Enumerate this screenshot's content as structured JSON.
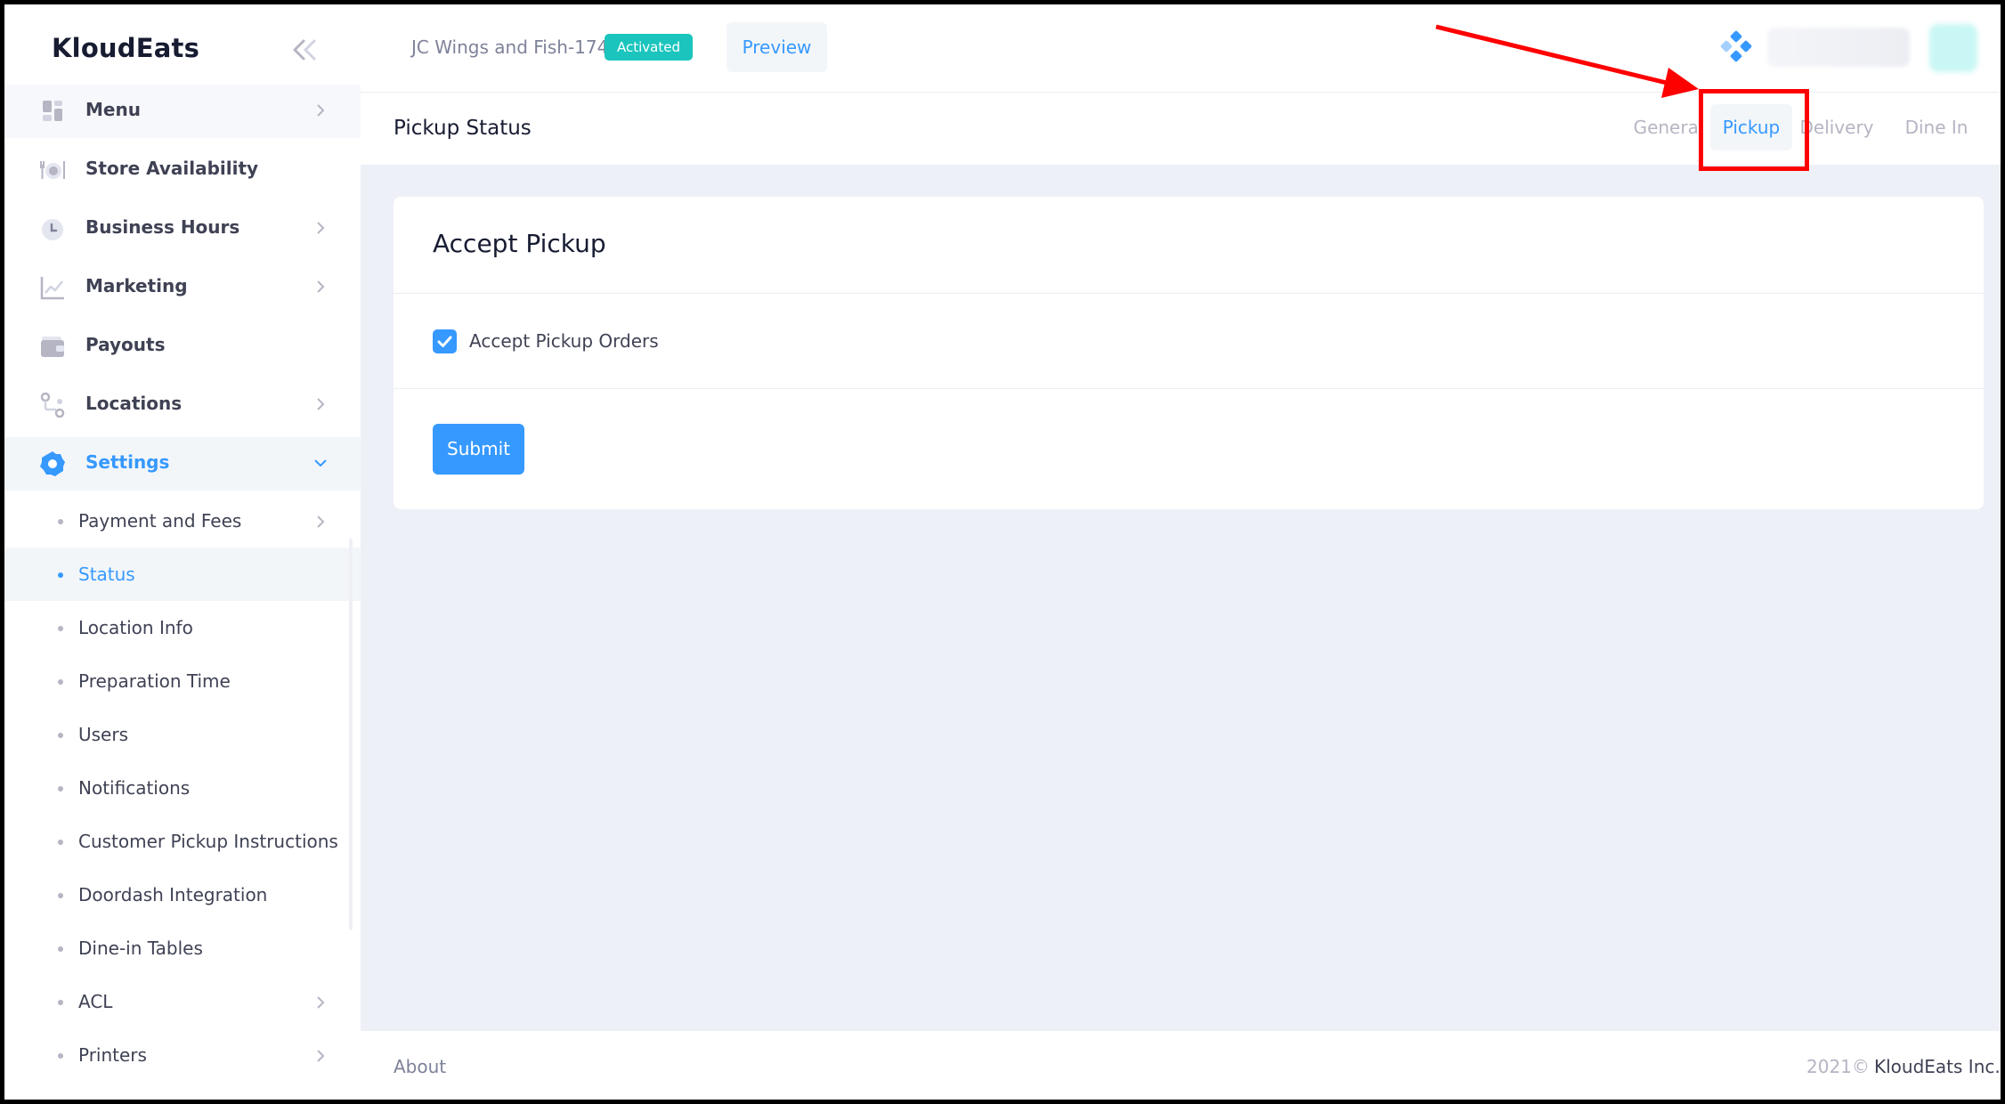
{
  "sidebar": {
    "brand": "KloudEats",
    "menu": [
      {
        "label": "Menu",
        "icon": "grid-icon",
        "has_arrow": true
      },
      {
        "label": "Store Availability",
        "icon": "dining-icon",
        "has_arrow": false
      },
      {
        "label": "Business Hours",
        "icon": "clock-icon",
        "has_arrow": true
      },
      {
        "label": "Marketing",
        "icon": "chart-line-icon",
        "has_arrow": true
      },
      {
        "label": "Payouts",
        "icon": "wallet-icon",
        "has_arrow": false
      },
      {
        "label": "Locations",
        "icon": "route-icon",
        "has_arrow": true
      },
      {
        "label": "Settings",
        "icon": "gear-icon",
        "has_arrow": true,
        "expanded": true
      }
    ],
    "settings_items": [
      {
        "label": "Payment and Fees",
        "has_arrow": true
      },
      {
        "label": "Status",
        "active": true
      },
      {
        "label": "Location Info"
      },
      {
        "label": "Preparation Time"
      },
      {
        "label": "Users"
      },
      {
        "label": "Notifications"
      },
      {
        "label": "Customer Pickup Instructions"
      },
      {
        "label": "Doordash Integration"
      },
      {
        "label": "Dine-in Tables"
      },
      {
        "label": "ACL",
        "has_arrow": true
      },
      {
        "label": "Printers",
        "has_arrow": true
      }
    ]
  },
  "header": {
    "store_name": "JC Wings and Fish-174",
    "status_badge": "Activated",
    "preview_label": "Preview"
  },
  "subheader": {
    "title": "Pickup Status",
    "tabs": [
      {
        "label": "General"
      },
      {
        "label": "Pickup",
        "active": true
      },
      {
        "label": "Delivery"
      },
      {
        "label": "Dine In"
      }
    ]
  },
  "card": {
    "title": "Accept Pickup",
    "checkbox_label": "Accept Pickup Orders",
    "checkbox_checked": true,
    "submit_label": "Submit"
  },
  "footer": {
    "about": "About",
    "year": "2021©",
    "company": "KloudEats Inc."
  },
  "colors": {
    "primary": "#3699ff",
    "success": "#1bc5bd",
    "annotation": "#ff0000"
  }
}
